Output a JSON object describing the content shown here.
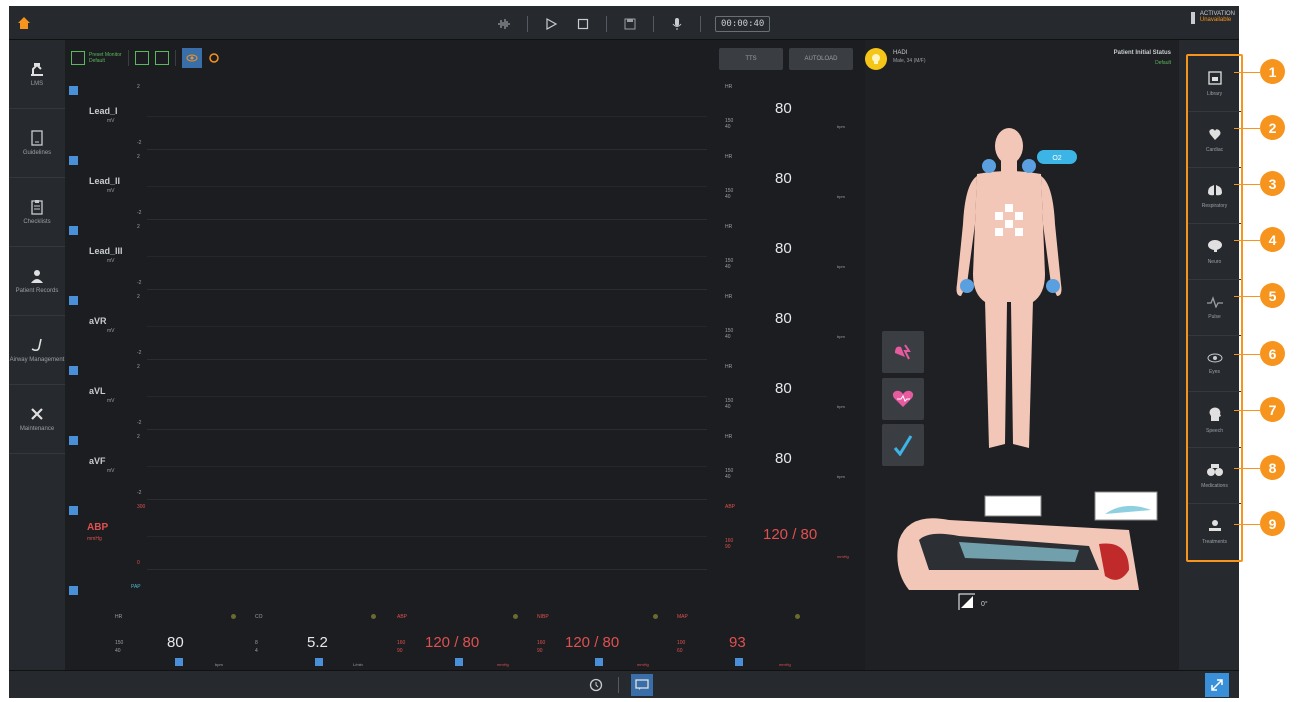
{
  "topbar": {
    "timer": "00:00:40",
    "activation_line1": "ACTIVATION",
    "activation_line2": "Unavailable"
  },
  "leftnav": {
    "items": [
      {
        "label": "LMS",
        "icon": "lms-icon"
      },
      {
        "label": "Guidelines",
        "icon": "guidelines-icon"
      },
      {
        "label": "Checklists",
        "icon": "clipboard-icon"
      },
      {
        "label": "Patient Records",
        "icon": "patient-records-icon"
      },
      {
        "label": "Airway Management",
        "icon": "airway-icon"
      },
      {
        "label": "Maintenance",
        "icon": "tools-icon"
      }
    ]
  },
  "monitor": {
    "layout_label_line1": "Preset Monitor",
    "layout_label_line2": "Default",
    "btn1": "TTS",
    "btn2": "AUTOLOAD",
    "leads": [
      {
        "name": "Lead_I",
        "unit": "mV",
        "top": "2",
        "bottom": "-2"
      },
      {
        "name": "Lead_II",
        "unit": "mV",
        "top": "2",
        "bottom": "-2"
      },
      {
        "name": "Lead_III",
        "unit": "mV",
        "top": "2",
        "bottom": "-2"
      },
      {
        "name": "aVR",
        "unit": "mV",
        "top": "2",
        "bottom": "-2"
      },
      {
        "name": "aVL",
        "unit": "mV",
        "top": "2",
        "bottom": "-2"
      },
      {
        "name": "aVF",
        "unit": "mV",
        "top": "2",
        "bottom": "-2"
      }
    ],
    "vital_rows": [
      {
        "label": "HR",
        "value": "80",
        "lim1": "150",
        "lim2": "40",
        "unit": "bpm"
      },
      {
        "label": "HR",
        "value": "80",
        "lim1": "150",
        "lim2": "40",
        "unit": "bpm"
      },
      {
        "label": "HR",
        "value": "80",
        "lim1": "150",
        "lim2": "40",
        "unit": "bpm"
      },
      {
        "label": "HR",
        "value": "80",
        "lim1": "150",
        "lim2": "40",
        "unit": "bpm"
      },
      {
        "label": "HR",
        "value": "80",
        "lim1": "150",
        "lim2": "40",
        "unit": "bpm"
      },
      {
        "label": "HR",
        "value": "80",
        "lim1": "150",
        "lim2": "40",
        "unit": "bpm"
      }
    ],
    "abp": {
      "name": "ABP",
      "unit": "mmHg",
      "top": "300",
      "bottom": "0",
      "label": "ABP",
      "value": "120 / 80",
      "lim1": "160",
      "lim2": "90",
      "vunit": "mmHg"
    },
    "pap_label": "PAP",
    "bottom_vitals": {
      "hr": {
        "label": "HR",
        "value": "80",
        "lim1": "150",
        "lim2": "40",
        "unit": "bpm"
      },
      "co": {
        "label": "CO",
        "value": "5.2",
        "lim1": "8",
        "lim2": "4",
        "unit": "L/min"
      },
      "abp": {
        "label": "ABP",
        "value": "120 / 80",
        "lim1": "160",
        "lim2": "90",
        "unit": "mmHg"
      },
      "nibp": {
        "label": "NIBP",
        "value": "120 / 80",
        "lim1": "160",
        "lim2": "90",
        "unit": "mmHg"
      },
      "map": {
        "label": "MAP",
        "value": "93",
        "lim1": "100",
        "lim2": "60",
        "unit": "mmHg"
      }
    }
  },
  "patient": {
    "name": "HADI",
    "dob": "Male, 34 (M/F)",
    "status_title": "Patient Initial Status",
    "status_value": "Default",
    "o2_tag": "O2"
  },
  "rightpanel": {
    "items": [
      {
        "label": "Library",
        "num": "1"
      },
      {
        "label": "Cardiac",
        "num": "2"
      },
      {
        "label": "Respiratory",
        "num": "3"
      },
      {
        "label": "Neuro",
        "num": "4"
      },
      {
        "label": "Pulse",
        "num": "5"
      },
      {
        "label": "Eyes",
        "num": "6"
      },
      {
        "label": "Speech",
        "num": "7"
      },
      {
        "label": "Medications",
        "num": "8"
      },
      {
        "label": "Treatments",
        "num": "9"
      }
    ]
  },
  "colors": {
    "accent": "#f7941d",
    "alarm_red": "#e05050",
    "selected_blue": "#3a6ea8",
    "green": "#5cb85c"
  }
}
